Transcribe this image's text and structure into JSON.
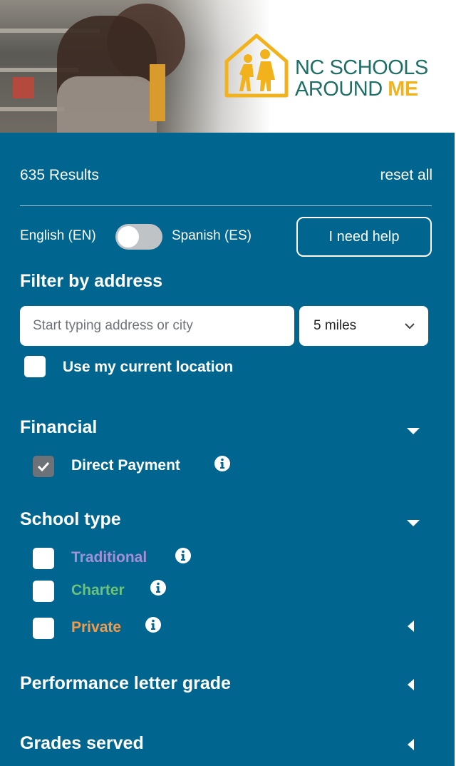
{
  "header": {
    "logo_line1": "NC SCHOOLS",
    "logo_line2_prefix": "AROUND ",
    "logo_line2_accent": "ME",
    "brand_teal": "#1f6f67",
    "brand_gold": "#f2b21b"
  },
  "panel": {
    "background": "#00658f",
    "results_text": "635 Results",
    "reset_label": "reset all",
    "lang_en": "English (EN)",
    "lang_es": "Spanish (ES)",
    "help_label": "I need help"
  },
  "address_filter": {
    "title": "Filter by address",
    "placeholder": "Start typing address or city",
    "distance": "5 miles",
    "use_location_label": "Use my current location"
  },
  "financial": {
    "title": "Financial",
    "items": [
      {
        "label": "Direct Payment",
        "checked": true
      }
    ]
  },
  "school_type": {
    "title": "School type",
    "items": [
      {
        "label": "Traditional",
        "color": "#a58fd6",
        "checked": false
      },
      {
        "label": "Charter",
        "color": "#6cc27a",
        "checked": false
      },
      {
        "label": "Private",
        "color": "#f39a4a",
        "checked": false
      }
    ]
  },
  "sections": {
    "performance": "Performance letter grade",
    "grades": "Grades served"
  }
}
